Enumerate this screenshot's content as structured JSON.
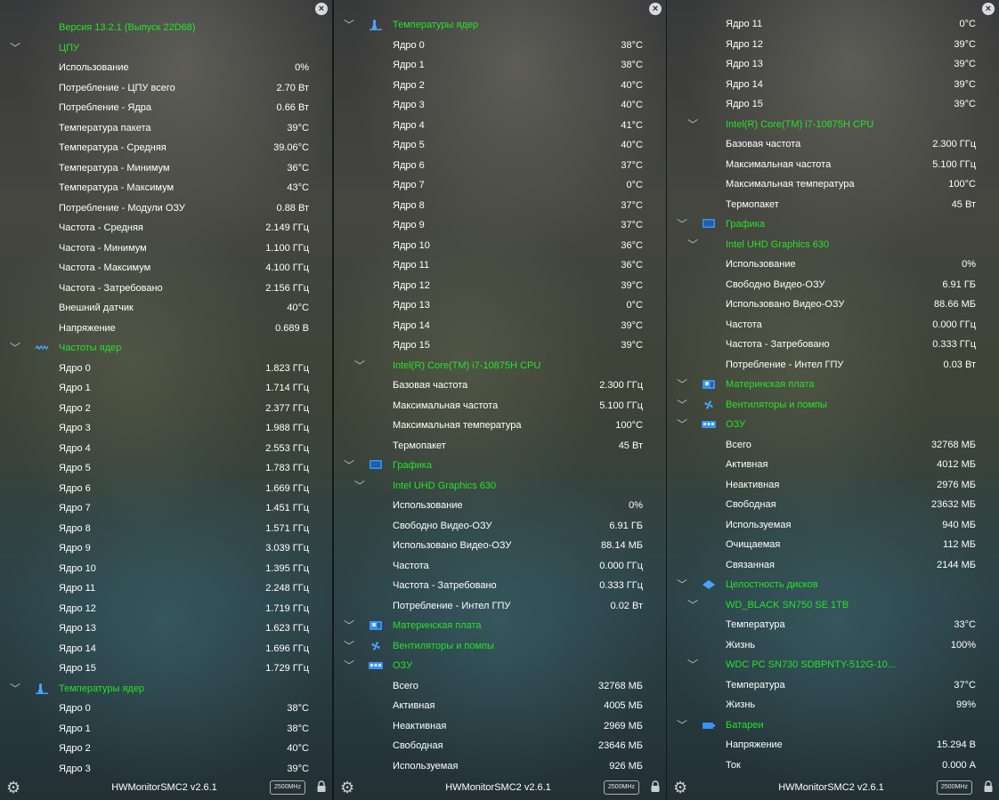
{
  "app": {
    "title": "HWMonitorSMC2 v2.6.1",
    "freq_badge": "2500MHz"
  },
  "panels": [
    {
      "rows": [
        {
          "kind": "header",
          "label": "Версия 13.2.1 (Выпуск 22D68)"
        },
        {
          "kind": "group",
          "icon": "",
          "label": "ЦПУ"
        },
        {
          "kind": "item",
          "label": "Использование",
          "value": "0%"
        },
        {
          "kind": "item",
          "label": "Потребление - ЦПУ всего",
          "value": "2.70 Вт"
        },
        {
          "kind": "item",
          "label": "Потребление - Ядра",
          "value": "0.66 Вт"
        },
        {
          "kind": "item",
          "label": "Температура пакета",
          "value": "39°C"
        },
        {
          "kind": "item",
          "label": "Температура - Средняя",
          "value": "39.06°C"
        },
        {
          "kind": "item",
          "label": "Температура - Минимум",
          "value": "36°C"
        },
        {
          "kind": "item",
          "label": "Температура - Максимум",
          "value": "43°C"
        },
        {
          "kind": "item",
          "label": "Потребление - Модули ОЗУ",
          "value": "0.88 Вт"
        },
        {
          "kind": "item",
          "label": "Частота - Средняя",
          "value": "2.149 ГГц"
        },
        {
          "kind": "item",
          "label": "Частота - Минимум",
          "value": "1.100 ГГц"
        },
        {
          "kind": "item",
          "label": "Частота - Максимум",
          "value": "4.100 ГГц"
        },
        {
          "kind": "item",
          "label": "Частота - Затребовано",
          "value": "2.156 ГГц"
        },
        {
          "kind": "item",
          "label": "Внешний датчик",
          "value": "40°C"
        },
        {
          "kind": "item",
          "label": "Напряжение",
          "value": "0.689 В"
        },
        {
          "kind": "group",
          "icon": "wave",
          "label": "Частоты ядер"
        },
        {
          "kind": "item",
          "label": "Ядро 0",
          "value": "1.823 ГГц"
        },
        {
          "kind": "item",
          "label": "Ядро 1",
          "value": "1.714 ГГц"
        },
        {
          "kind": "item",
          "label": "Ядро 2",
          "value": "2.377 ГГц"
        },
        {
          "kind": "item",
          "label": "Ядро 3",
          "value": "1.988 ГГц"
        },
        {
          "kind": "item",
          "label": "Ядро 4",
          "value": "2.553 ГГц"
        },
        {
          "kind": "item",
          "label": "Ядро 5",
          "value": "1.783 ГГц"
        },
        {
          "kind": "item",
          "label": "Ядро 6",
          "value": "1.669 ГГц"
        },
        {
          "kind": "item",
          "label": "Ядро 7",
          "value": "1.451 ГГц"
        },
        {
          "kind": "item",
          "label": "Ядро 8",
          "value": "1.571 ГГц"
        },
        {
          "kind": "item",
          "label": "Ядро 9",
          "value": "3.039 ГГц"
        },
        {
          "kind": "item",
          "label": "Ядро 10",
          "value": "1.395 ГГц"
        },
        {
          "kind": "item",
          "label": "Ядро 11",
          "value": "2.248 ГГц"
        },
        {
          "kind": "item",
          "label": "Ядро 12",
          "value": "1.719 ГГц"
        },
        {
          "kind": "item",
          "label": "Ядро 13",
          "value": "1.623 ГГц"
        },
        {
          "kind": "item",
          "label": "Ядро 14",
          "value": "1.696 ГГц"
        },
        {
          "kind": "item",
          "label": "Ядро 15",
          "value": "1.729 ГГц"
        },
        {
          "kind": "group",
          "icon": "thermo",
          "label": "Температуры ядер"
        },
        {
          "kind": "item",
          "label": "Ядро 0",
          "value": "38°C"
        },
        {
          "kind": "item",
          "label": "Ядро 1",
          "value": "38°C"
        },
        {
          "kind": "item",
          "label": "Ядро 2",
          "value": "40°C"
        },
        {
          "kind": "item",
          "label": "Ядро 3",
          "value": "39°C"
        }
      ]
    },
    {
      "rows": [
        {
          "kind": "group",
          "icon": "thermo",
          "label": "Температуры ядер"
        },
        {
          "kind": "item",
          "label": "Ядро 0",
          "value": "38°C"
        },
        {
          "kind": "item",
          "label": "Ядро 1",
          "value": "38°C"
        },
        {
          "kind": "item",
          "label": "Ядро 2",
          "value": "40°C"
        },
        {
          "kind": "item",
          "label": "Ядро 3",
          "value": "40°C"
        },
        {
          "kind": "item",
          "label": "Ядро 4",
          "value": "41°C"
        },
        {
          "kind": "item",
          "label": "Ядро 5",
          "value": "40°C"
        },
        {
          "kind": "item",
          "label": "Ядро 6",
          "value": "37°C"
        },
        {
          "kind": "item",
          "label": "Ядро 7",
          "value": "0°C"
        },
        {
          "kind": "item",
          "label": "Ядро 8",
          "value": "37°C"
        },
        {
          "kind": "item",
          "label": "Ядро 9",
          "value": "37°C"
        },
        {
          "kind": "item",
          "label": "Ядро 10",
          "value": "36°C"
        },
        {
          "kind": "item",
          "label": "Ядро 11",
          "value": "36°C"
        },
        {
          "kind": "item",
          "label": "Ядро 12",
          "value": "39°C"
        },
        {
          "kind": "item",
          "label": "Ядро 13",
          "value": "0°C"
        },
        {
          "kind": "item",
          "label": "Ядро 14",
          "value": "39°C"
        },
        {
          "kind": "item",
          "label": "Ядро 15",
          "value": "39°C"
        },
        {
          "kind": "sub",
          "label": "Intel(R) Core(TM) i7-10875H CPU"
        },
        {
          "kind": "item",
          "label": "Базовая частота",
          "value": "2.300 ГГц"
        },
        {
          "kind": "item",
          "label": "Максимальная частота",
          "value": "5.100 ГГц"
        },
        {
          "kind": "item",
          "label": "Максимальная температура",
          "value": "100°C"
        },
        {
          "kind": "item",
          "label": "Термопакет",
          "value": "45 Вт"
        },
        {
          "kind": "group",
          "icon": "monitor",
          "label": "Графика"
        },
        {
          "kind": "sub",
          "label": "Intel UHD Graphics 630"
        },
        {
          "kind": "item",
          "label": "Использование",
          "value": "0%"
        },
        {
          "kind": "item",
          "label": "Свободно Видео-ОЗУ",
          "value": "6.91 ГБ"
        },
        {
          "kind": "item",
          "label": "Использовано Видео-ОЗУ",
          "value": "88.14 МБ"
        },
        {
          "kind": "item",
          "label": "Частота",
          "value": "0.000 ГГц"
        },
        {
          "kind": "item",
          "label": "Частота - Затребовано",
          "value": "0.333 ГГц"
        },
        {
          "kind": "item",
          "label": "Потребление - Интел ГПУ",
          "value": "0.02 Вт"
        },
        {
          "kind": "group",
          "icon": "board",
          "label": "Материнская плата"
        },
        {
          "kind": "group",
          "icon": "fan",
          "label": "Вентиляторы и помпы"
        },
        {
          "kind": "group",
          "icon": "ram",
          "label": "ОЗУ"
        },
        {
          "kind": "item",
          "label": "Всего",
          "value": "32768 МБ"
        },
        {
          "kind": "item",
          "label": "Активная",
          "value": "4005 МБ"
        },
        {
          "kind": "item",
          "label": "Неактивная",
          "value": "2969 МБ"
        },
        {
          "kind": "item",
          "label": "Свободная",
          "value": "23646 МБ"
        },
        {
          "kind": "item",
          "label": "Используемая",
          "value": "926 МБ"
        }
      ]
    },
    {
      "rows": [
        {
          "kind": "item",
          "label": "Ядро 11",
          "value": "0°C"
        },
        {
          "kind": "item",
          "label": "Ядро 12",
          "value": "39°C"
        },
        {
          "kind": "item",
          "label": "Ядро 13",
          "value": "39°C"
        },
        {
          "kind": "item",
          "label": "Ядро 14",
          "value": "39°C"
        },
        {
          "kind": "item",
          "label": "Ядро 15",
          "value": "39°C"
        },
        {
          "kind": "sub",
          "label": "Intel(R) Core(TM) i7-10875H CPU"
        },
        {
          "kind": "item",
          "label": "Базовая частота",
          "value": "2.300 ГГц"
        },
        {
          "kind": "item",
          "label": "Максимальная частота",
          "value": "5.100 ГГц"
        },
        {
          "kind": "item",
          "label": "Максимальная температура",
          "value": "100°C"
        },
        {
          "kind": "item",
          "label": "Термопакет",
          "value": "45 Вт"
        },
        {
          "kind": "group",
          "icon": "monitor",
          "label": "Графика"
        },
        {
          "kind": "sub",
          "label": "Intel UHD Graphics 630"
        },
        {
          "kind": "item",
          "label": "Использование",
          "value": "0%"
        },
        {
          "kind": "item",
          "label": "Свободно Видео-ОЗУ",
          "value": "6.91 ГБ"
        },
        {
          "kind": "item",
          "label": "Использовано Видео-ОЗУ",
          "value": "88.66 МБ"
        },
        {
          "kind": "item",
          "label": "Частота",
          "value": "0.000 ГГц"
        },
        {
          "kind": "item",
          "label": "Частота - Затребовано",
          "value": "0.333 ГГц"
        },
        {
          "kind": "item",
          "label": "Потребление - Интел ГПУ",
          "value": "0.03 Вт"
        },
        {
          "kind": "group",
          "icon": "board",
          "label": "Материнская плата"
        },
        {
          "kind": "group",
          "icon": "fan",
          "label": "Вентиляторы и помпы"
        },
        {
          "kind": "group",
          "icon": "ram",
          "label": "ОЗУ"
        },
        {
          "kind": "item",
          "label": "Всего",
          "value": "32768 МБ"
        },
        {
          "kind": "item",
          "label": "Активная",
          "value": "4012 МБ"
        },
        {
          "kind": "item",
          "label": "Неактивная",
          "value": "2976 МБ"
        },
        {
          "kind": "item",
          "label": "Свободная",
          "value": "23632 МБ"
        },
        {
          "kind": "item",
          "label": "Используемая",
          "value": "940 МБ"
        },
        {
          "kind": "item",
          "label": "Очищаемая",
          "value": "112 МБ"
        },
        {
          "kind": "item",
          "label": "Связанная",
          "value": "2144 МБ"
        },
        {
          "kind": "group",
          "icon": "disk",
          "label": "Целостность дисков"
        },
        {
          "kind": "sub",
          "label": "WD_BLACK SN750 SE 1TB"
        },
        {
          "kind": "item",
          "label": "Температура",
          "value": "33°C"
        },
        {
          "kind": "item",
          "label": "Жизнь",
          "value": "100%"
        },
        {
          "kind": "sub",
          "label": "WDC PC SN730 SDBPNTY-512G-10..."
        },
        {
          "kind": "item",
          "label": "Температура",
          "value": "37°C"
        },
        {
          "kind": "item",
          "label": "Жизнь",
          "value": "99%"
        },
        {
          "kind": "group",
          "icon": "battery",
          "label": "Батареи"
        },
        {
          "kind": "item",
          "label": "Напряжение",
          "value": "15.294 В"
        },
        {
          "kind": "item",
          "label": "Ток",
          "value": "0.000 А"
        }
      ]
    }
  ]
}
